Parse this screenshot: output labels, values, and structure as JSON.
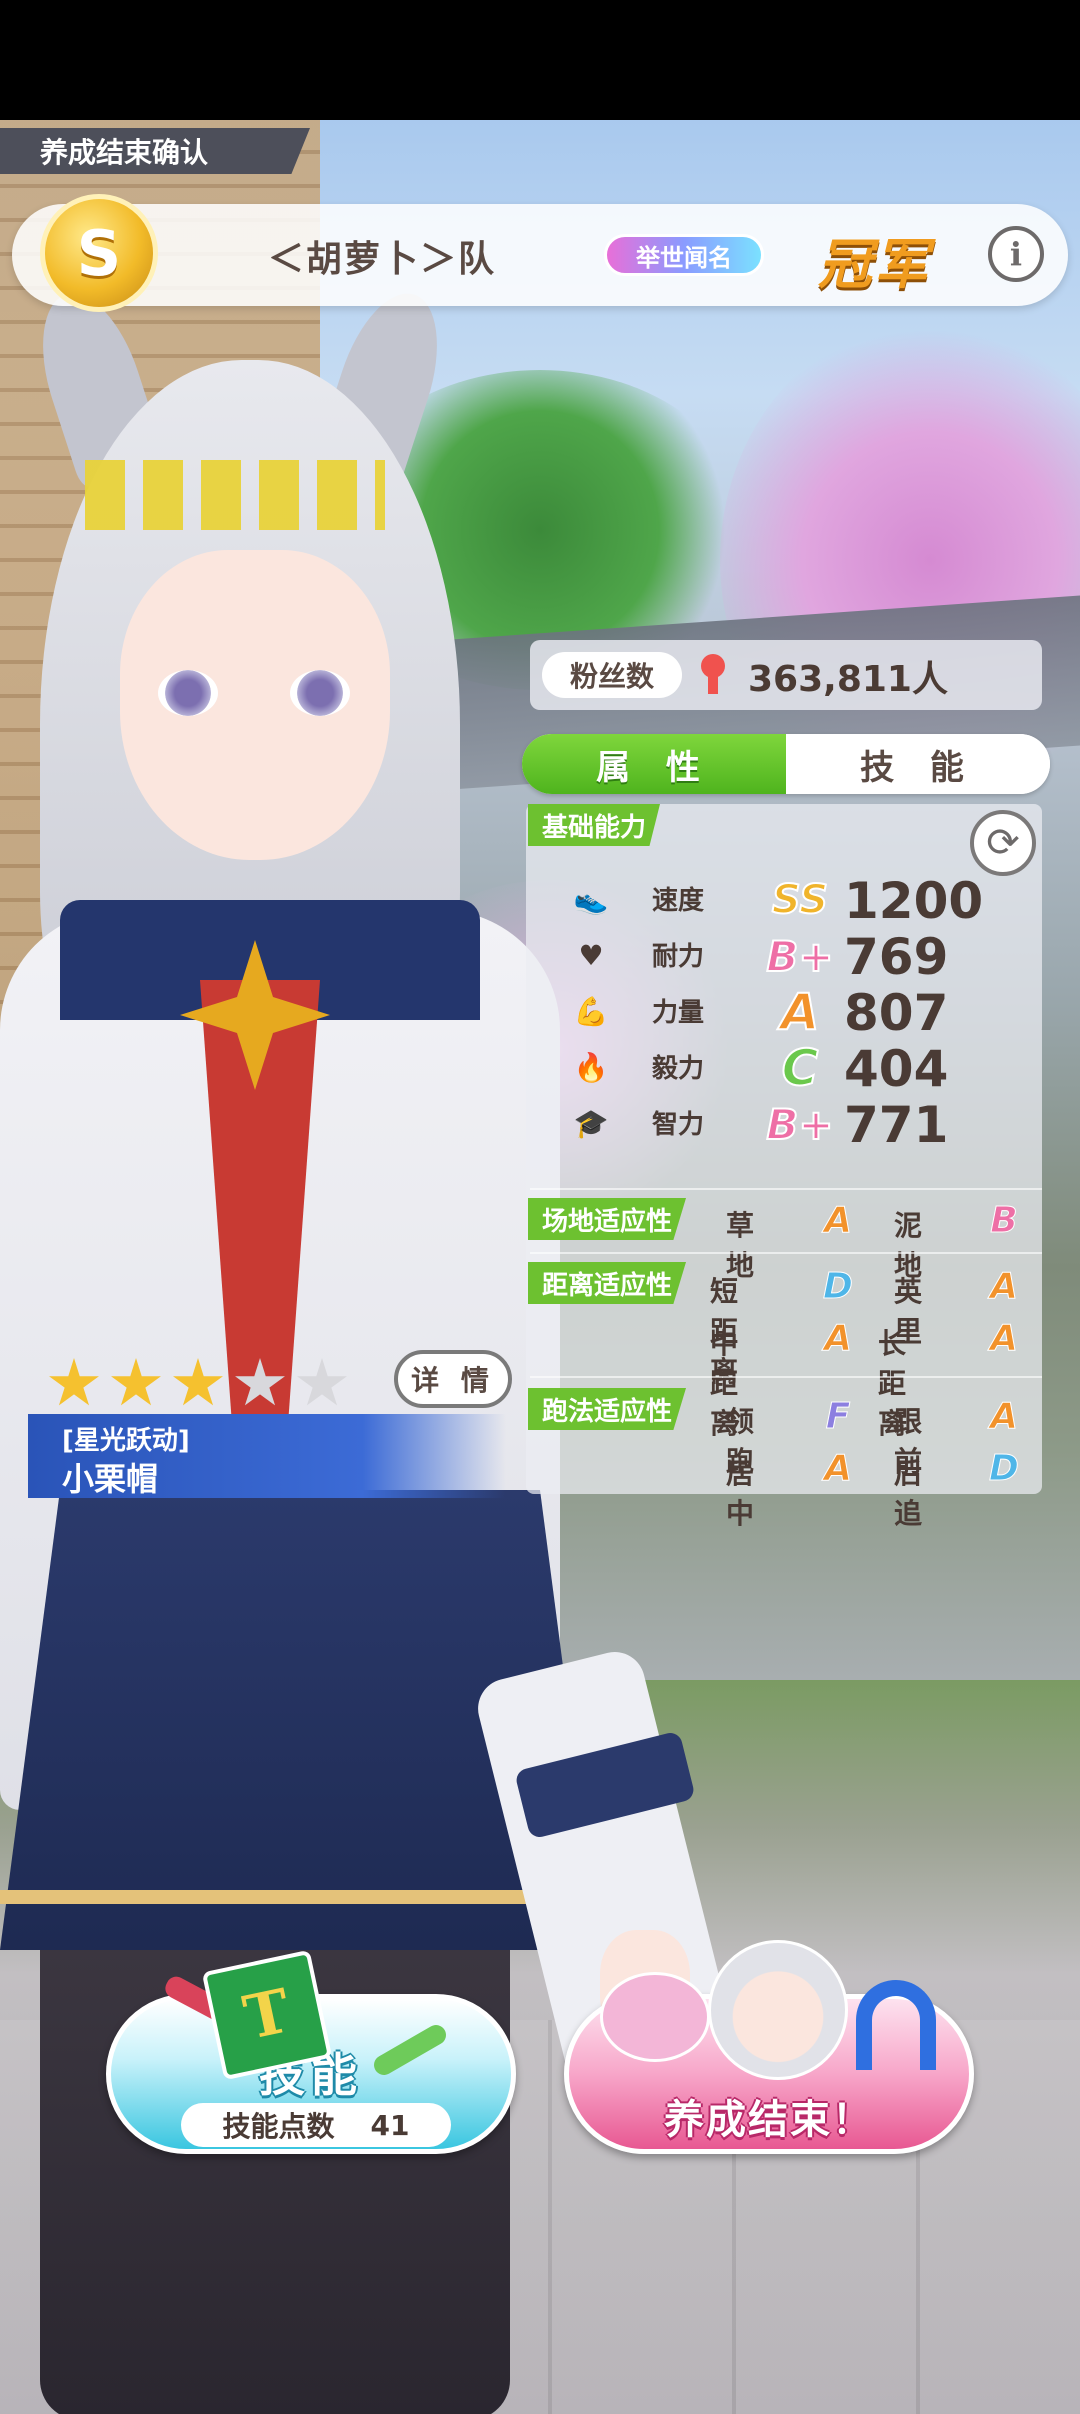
{
  "header": {
    "tag": "养成结束确认",
    "rank_badge": "S",
    "team_name": "＜胡萝卜＞队",
    "title_pill": "举世闻名",
    "result": "冠军",
    "info_icon": "i"
  },
  "fans": {
    "label": "粉丝数",
    "value": "363,811人",
    "icon": "person-icon"
  },
  "tabs": [
    {
      "label": "属 性",
      "active": true
    },
    {
      "label": "技 能",
      "active": false
    }
  ],
  "basic": {
    "section_label": "基础能力",
    "stats": [
      {
        "icon": "shoe-icon",
        "label": "速度",
        "grade": "SS",
        "value": "1200"
      },
      {
        "icon": "heart-icon",
        "label": "耐力",
        "grade": "B+",
        "value": "769"
      },
      {
        "icon": "muscle-icon",
        "label": "力量",
        "grade": "A",
        "value": "807"
      },
      {
        "icon": "flame-icon",
        "label": "毅力",
        "grade": "C",
        "value": "404"
      },
      {
        "icon": "grad-cap-icon",
        "label": "智力",
        "grade": "B+",
        "value": "771"
      }
    ]
  },
  "aptitude": {
    "field": {
      "section_label": "场地适应性",
      "items": [
        {
          "label": "草地",
          "grade": "A"
        },
        {
          "label": "泥地",
          "grade": "B"
        }
      ]
    },
    "distance": {
      "section_label": "距离适应性",
      "items": [
        {
          "label": "短距离",
          "grade": "D"
        },
        {
          "label": "英里",
          "grade": "A"
        },
        {
          "label": "中距离",
          "grade": "A"
        },
        {
          "label": "长距离",
          "grade": "A"
        }
      ]
    },
    "style": {
      "section_label": "跑法适应性",
      "items": [
        {
          "label": "领跑",
          "grade": "F"
        },
        {
          "label": "跟前",
          "grade": "A"
        },
        {
          "label": "居中",
          "grade": "A"
        },
        {
          "label": "后追",
          "grade": "D"
        }
      ]
    }
  },
  "card": {
    "stars_filled": 3,
    "stars_total": 5,
    "detail_button": "详 情",
    "title": "[星光跃动]",
    "name": "小栗帽"
  },
  "buttons": {
    "skill": {
      "label": "技能",
      "points_label": "技能点数",
      "points_value": "41"
    },
    "end": {
      "label": "养成结束！"
    }
  },
  "colors": {
    "accent_green": "#6dc130",
    "grade_A": "#f2922b",
    "grade_B": "#ee6fa6",
    "grade_C": "#6ac84c",
    "grade_D": "#4fb6e8",
    "grade_F": "#8c7fe0",
    "grade_SS": "#f0b42b"
  }
}
